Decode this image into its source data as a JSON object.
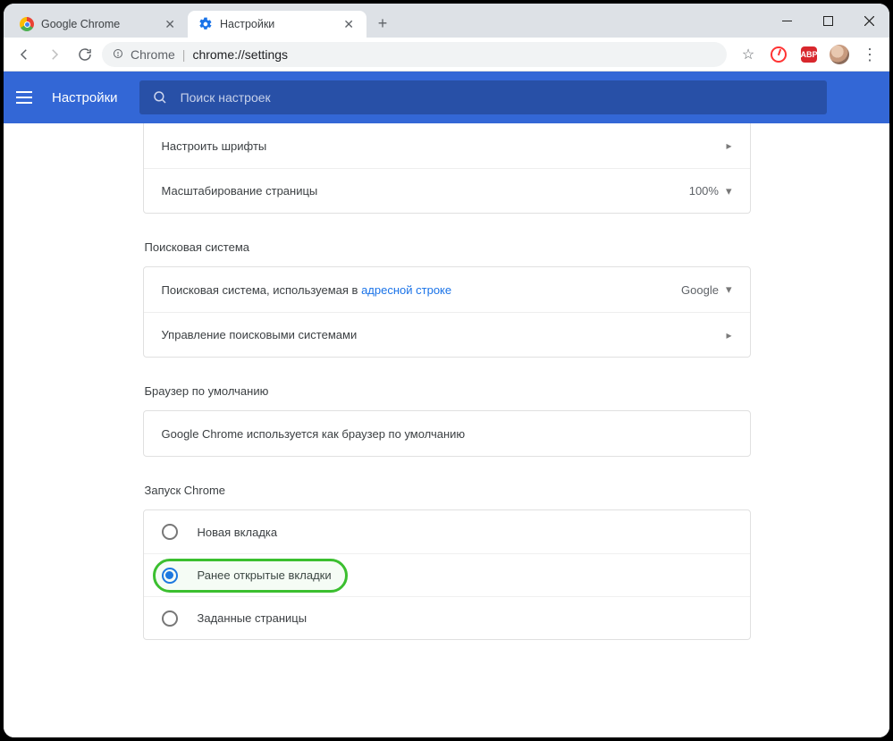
{
  "tabs": [
    {
      "label": "Google Chrome"
    },
    {
      "label": "Настройки"
    }
  ],
  "omnibox": {
    "chip": "Chrome",
    "url": "chrome://settings"
  },
  "header": {
    "title": "Настройки"
  },
  "search": {
    "placeholder": "Поиск настроек"
  },
  "appearance": {
    "fonts_label": "Настроить шрифты",
    "zoom_label": "Масштабирование страницы",
    "zoom_value": "100%"
  },
  "search_engine": {
    "section_title": "Поисковая система",
    "row1_prefix": "Поисковая система, используемая в ",
    "row1_link": "адресной строке",
    "row1_value": "Google",
    "row2_label": "Управление поисковыми системами"
  },
  "default_browser": {
    "section_title": "Браузер по умолчанию",
    "text": "Google Chrome используется как браузер по умолчанию"
  },
  "startup": {
    "section_title": "Запуск Chrome",
    "options": [
      "Новая вкладка",
      "Ранее открытые вкладки",
      "Заданные страницы"
    ]
  },
  "abp_label": "ABP"
}
